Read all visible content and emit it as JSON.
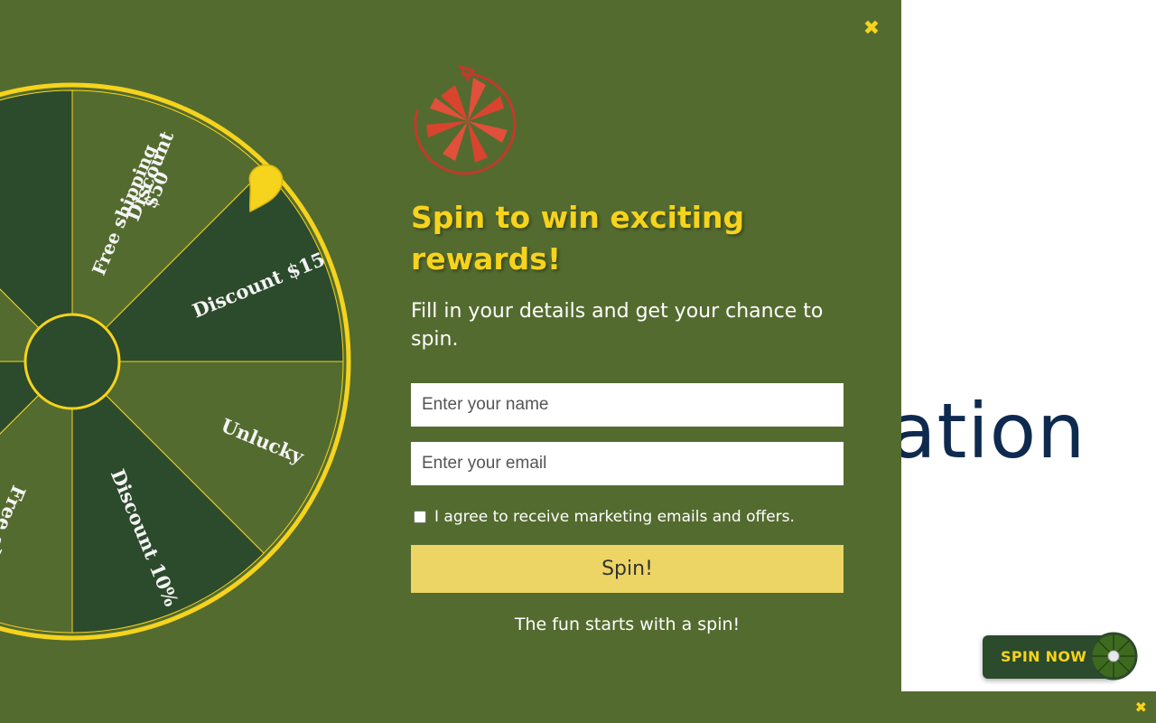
{
  "background": {
    "partial_text": "ation",
    "text_color": "#0f2a4f"
  },
  "popup": {
    "close_icon": "close-icon",
    "logo_icon": "gift-wheel-icon",
    "headline": "Spin to win exciting rewards!",
    "subtext": "Fill in your details and get your chance to spin.",
    "name_placeholder": "Enter your name",
    "email_placeholder": "Enter your email",
    "consent_label": "I agree to receive marketing emails and offers.",
    "consent_checked": false,
    "spin_button": "Spin!",
    "tagline": "The fun starts with a spin!",
    "colors": {
      "panel": "#546b2f",
      "accent": "#f6d31c",
      "button": "#ecd564",
      "segment_dark": "#2c4a2c",
      "segment_light": "#546b2f"
    }
  },
  "wheel": {
    "segments": [
      {
        "label": "Discount",
        "shade": "dark"
      },
      {
        "label": "Free shipping $50",
        "shade": "light"
      },
      {
        "label": "Discount $15",
        "shade": "dark"
      },
      {
        "label": "Unlucky",
        "shade": "light"
      },
      {
        "label": "Discount 10%",
        "shade": "dark"
      },
      {
        "label": "Free sh",
        "shade": "light"
      }
    ],
    "pointer_icon": "pointer-icon"
  },
  "launcher": {
    "label": "SPIN NOW",
    "icon": "mini-wheel-icon"
  },
  "bottom_bar": {
    "close_icon": "close-icon"
  }
}
